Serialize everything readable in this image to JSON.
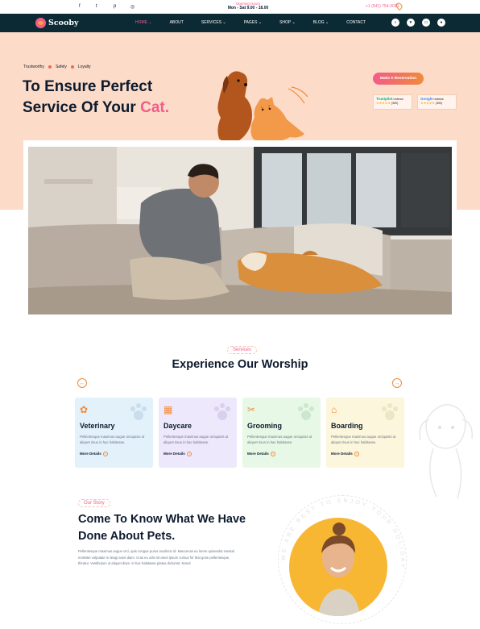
{
  "topbar": {
    "social_icons": [
      "facebook-icon",
      "twitter-icon",
      "pinterest-icon",
      "instagram-icon"
    ],
    "hours_label": "Opening Hours",
    "hours_value": "Mon - Sat 9.00 - 18.00",
    "phone": "+1 (541) 754-3010"
  },
  "nav": {
    "logo": "Scooby",
    "items": [
      {
        "label": "HOME",
        "active": true,
        "dropdown": true
      },
      {
        "label": "ABOUT",
        "active": false,
        "dropdown": false
      },
      {
        "label": "SERVICES",
        "active": false,
        "dropdown": true
      },
      {
        "label": "PAGES",
        "active": false,
        "dropdown": true
      },
      {
        "label": "SHOP",
        "active": false,
        "dropdown": true
      },
      {
        "label": "BLOG",
        "active": false,
        "dropdown": true
      },
      {
        "label": "CONTACT",
        "active": false,
        "dropdown": false
      }
    ],
    "icons": [
      "search-icon",
      "heart-icon",
      "cart-icon",
      "user-icon"
    ]
  },
  "hero": {
    "tags": [
      "Trustworthy",
      "Safely",
      "Loyalty"
    ],
    "title_line1": "To Ensure Perfect",
    "title_line2_prefix": "Service Of Your",
    "title_highlight": "Cat.",
    "cta": "Make A Reservation",
    "reviews": [
      {
        "brand": "Trustpilot",
        "label": "reviews",
        "stars": "★★★★★",
        "count": "(300)"
      },
      {
        "brand": "Google",
        "label": "reviews",
        "stars": "★★★★★",
        "count": "(300)"
      }
    ]
  },
  "services": {
    "label": "Services",
    "title": "Experience Our Worship",
    "cards": [
      {
        "title": "Veterinary",
        "desc": "Pellentesque maximus augue orciquisis ut aliquet risus in hac habitasse.",
        "more": "More Details",
        "bg": "#e3f1fb"
      },
      {
        "title": "Daycare",
        "desc": "Pellentesque maximus augue orciquisis ut aliquet risus in hac habitasse.",
        "more": "More Details",
        "bg": "#ede8fb"
      },
      {
        "title": "Grooming",
        "desc": "Pellentesque maximus augue orciquisis ut aliquet risus in hac habitasse.",
        "more": "More Details",
        "bg": "#e8f8e6"
      },
      {
        "title": "Boarding",
        "desc": "Pellentesque maximus augue orciquisis ut aliquet risus in hac habitasse.",
        "more": "More Details",
        "bg": "#fbf6dc"
      }
    ]
  },
  "story": {
    "label": "Our Story",
    "title": "Come To Know What We Have Done About Pets.",
    "text": "Pellentesque maximus augue orci, quis congue purus iaculison id. Maecenas eu lorem quisesdot massal molestie vulputate in sitagi amet diam. Cras eu odio sit amet ipsum cursus for that gone pellentesque, thiratur. Vestibulum ut aliquet diam. In hac habitasse platea dictumst. Nonot",
    "ring_text": "WE ARE BEST TO ENJOY YOUR HOLIDAY"
  },
  "colors": {
    "nav_bg": "#0c2a33",
    "hero_bg": "#fcdcc8",
    "accent_pink": "#f25c8a",
    "accent_orange": "#f08a3a"
  }
}
